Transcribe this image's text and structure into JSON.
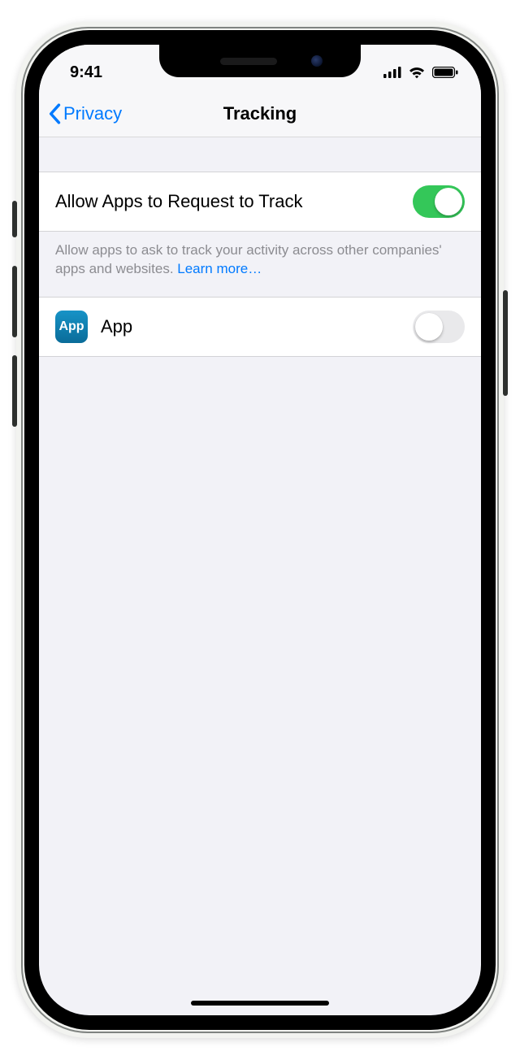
{
  "status": {
    "time": "9:41"
  },
  "nav": {
    "back_label": "Privacy",
    "title": "Tracking"
  },
  "settings": {
    "allow_label": "Allow Apps to Request to Track",
    "allow_on": true,
    "footer": {
      "text": "Allow apps to ask to track your activity across other companies' apps and websites. ",
      "learn_more": "Learn more…"
    },
    "apps": [
      {
        "name": "App",
        "icon_text": "App",
        "enabled": false
      }
    ]
  }
}
